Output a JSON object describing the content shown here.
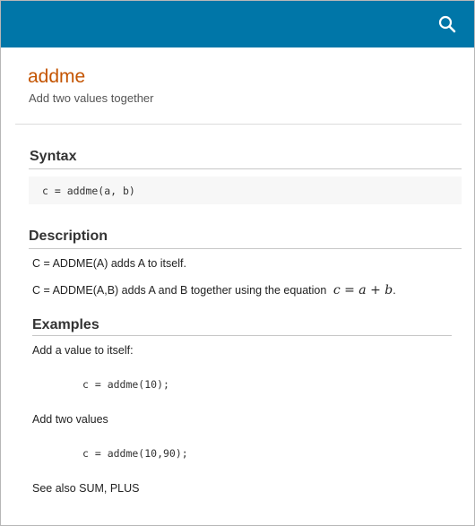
{
  "header": {
    "search_icon": "search-icon",
    "accent_color": "#0076a8"
  },
  "page": {
    "title": "addme",
    "subtitle": "Add two values together"
  },
  "syntax": {
    "heading": "Syntax",
    "code": "c = addme(a, b)"
  },
  "description": {
    "heading": "Description",
    "line1": "C = ADDME(A) adds A to itself.",
    "line2_text": "C = ADDME(A,B) adds A and B together using the equation",
    "line2_equation": "c = a + b",
    "line2_end": "."
  },
  "examples": {
    "heading": "Examples",
    "ex1_text": "Add a value to itself:",
    "ex1_code": "c = addme(10);",
    "ex2_text": "Add two values",
    "ex2_code": "c = addme(10,90);",
    "see_also": "See also SUM, PLUS"
  }
}
